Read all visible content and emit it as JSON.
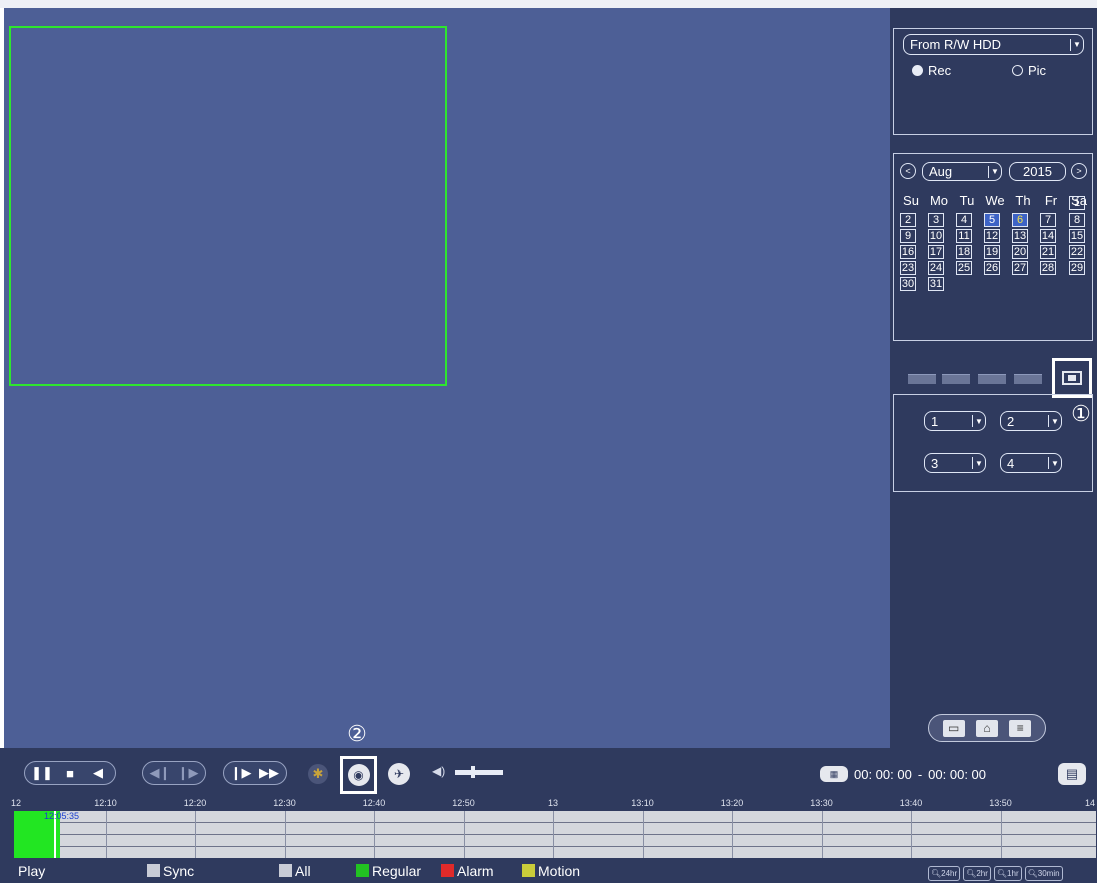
{
  "source": {
    "selected": "From R/W HDD",
    "radios": [
      {
        "label": "Rec",
        "checked": true
      },
      {
        "label": "Pic",
        "checked": false
      }
    ]
  },
  "calendar": {
    "month": "Aug",
    "year": "2015",
    "prev_icon": "<",
    "next_icon": ">",
    "weekdays": [
      "Su",
      "Mo",
      "Tu",
      "We",
      "Th",
      "Fr",
      "Sa"
    ],
    "days_with_records": [
      "5",
      "6"
    ],
    "selected_day": "6",
    "days": [
      "1",
      "2",
      "3",
      "4",
      "5",
      "6",
      "7",
      "8",
      "9",
      "10",
      "11",
      "12",
      "13",
      "14",
      "15",
      "16",
      "17",
      "18",
      "19",
      "20",
      "21",
      "22",
      "23",
      "24",
      "25",
      "26",
      "27",
      "28",
      "29",
      "30",
      "31"
    ]
  },
  "layout": {
    "icons": [
      "single-view-icon",
      "quad-view-icon",
      "nine-view-icon",
      "sixteen-view-icon",
      "custom-view-icon"
    ]
  },
  "channels": {
    "values": [
      "1",
      "2",
      "3",
      "4"
    ]
  },
  "annotations": {
    "mark1": "①",
    "mark2": "②"
  },
  "view_switch": {
    "icons": [
      "video-view-icon",
      "home-icon",
      "list-icon"
    ]
  },
  "controls": {
    "group1": [
      "pause-icon",
      "stop-icon",
      "play-backward-icon"
    ],
    "group2": [
      "previous-frame-icon",
      "next-frame-icon"
    ],
    "group3": [
      "slow-play-icon",
      "fast-forward-icon"
    ],
    "extra": [
      "smart-search-icon",
      "snapshot-icon",
      "pin-icon",
      "volume-icon"
    ]
  },
  "time": {
    "start": "00: 00: 00",
    "separator": "-",
    "end": "00: 00: 00"
  },
  "timeline": {
    "ticks": [
      "12",
      "12:10",
      "12:20",
      "12:30",
      "12:40",
      "12:50",
      "13",
      "13:10",
      "13:20",
      "13:30",
      "13:40",
      "13:50",
      "14"
    ],
    "cursor_label": "12:05:35"
  },
  "bottom": {
    "play_label": "Play",
    "sync_label": "Sync",
    "all_label": "All",
    "legend": [
      {
        "label": "Regular",
        "color": "#22c322"
      },
      {
        "label": "Alarm",
        "color": "#e12a2a"
      },
      {
        "label": "Motion",
        "color": "#c9cc3a"
      }
    ],
    "zoom": [
      "24hr",
      "2hr",
      "1hr",
      "30min"
    ]
  },
  "colors": {
    "video_bg": "#4d5f96",
    "panel_bg": "#2f3a5e",
    "record": "#22e622"
  }
}
